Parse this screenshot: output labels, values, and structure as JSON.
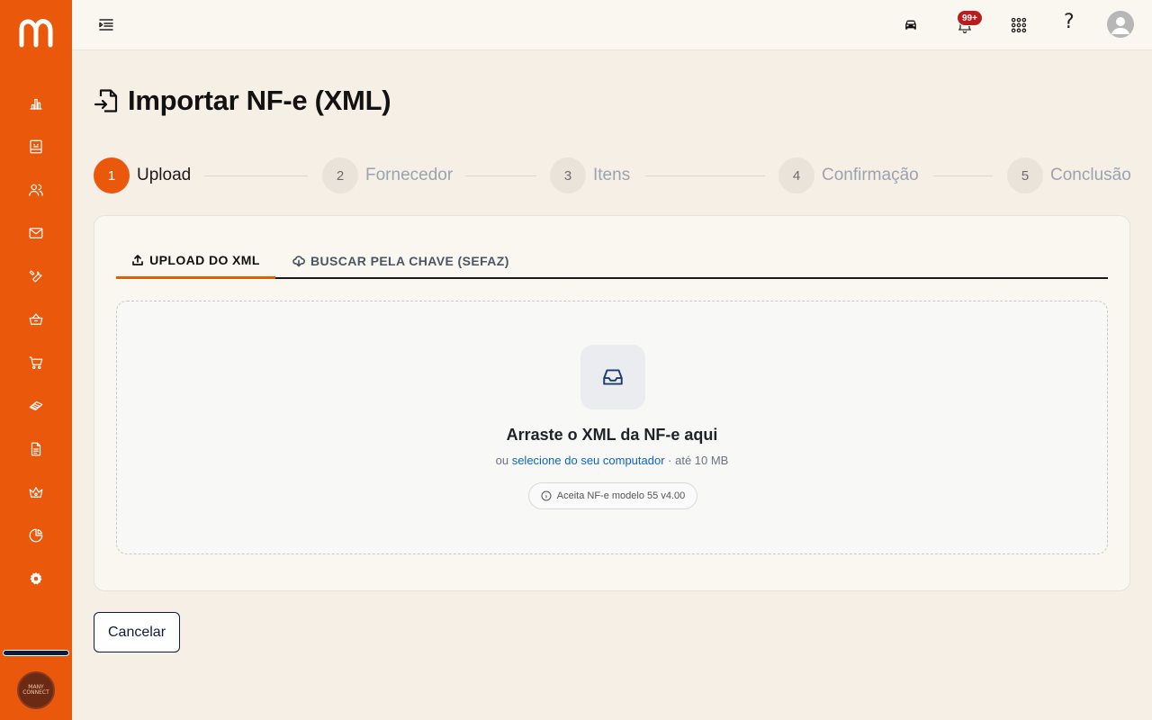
{
  "sidebar": {
    "logo_icon": "m-logo-icon",
    "items": [
      {
        "icon": "bar-chart-icon"
      },
      {
        "icon": "dashboard-icon"
      },
      {
        "icon": "users-icon"
      },
      {
        "icon": "mail-icon"
      },
      {
        "icon": "wrench-icon"
      },
      {
        "icon": "basket-icon"
      },
      {
        "icon": "cart-icon"
      },
      {
        "icon": "tire-icon"
      },
      {
        "icon": "document-icon"
      },
      {
        "icon": "crown-icon"
      },
      {
        "icon": "pie-chart-icon"
      },
      {
        "icon": "gear-icon"
      }
    ],
    "brand_avatar_text": "MANY CONNECT"
  },
  "topbar": {
    "notification_badge": "99+",
    "help_label": "?"
  },
  "page": {
    "title": "Importar NF-e (XML)"
  },
  "stepper": {
    "steps": [
      {
        "number": "1",
        "label": "Upload",
        "state": "active"
      },
      {
        "number": "2",
        "label": "Fornecedor",
        "state": "inactive"
      },
      {
        "number": "3",
        "label": "Itens",
        "state": "inactive"
      },
      {
        "number": "4",
        "label": "Confirmação",
        "state": "inactive"
      },
      {
        "number": "5",
        "label": "Conclusão",
        "state": "inactive"
      }
    ]
  },
  "tabs": {
    "upload_label": "UPLOAD DO XML",
    "sefaz_label": "BUSCAR PELA CHAVE (SEFAZ)"
  },
  "dropzone": {
    "title": "Arraste o XML da NF-e aqui",
    "prefix": "ou ",
    "link_text": "selecione do seu computador",
    "suffix": " · até 10 MB",
    "hint": "Aceita NF-e modelo 55 v4.00"
  },
  "actions": {
    "cancel_label": "Cancelar"
  },
  "colors": {
    "accent": "#ea580c",
    "navy": "#0d1b3e",
    "link": "#0b64c8",
    "badge": "#b91c1c"
  }
}
